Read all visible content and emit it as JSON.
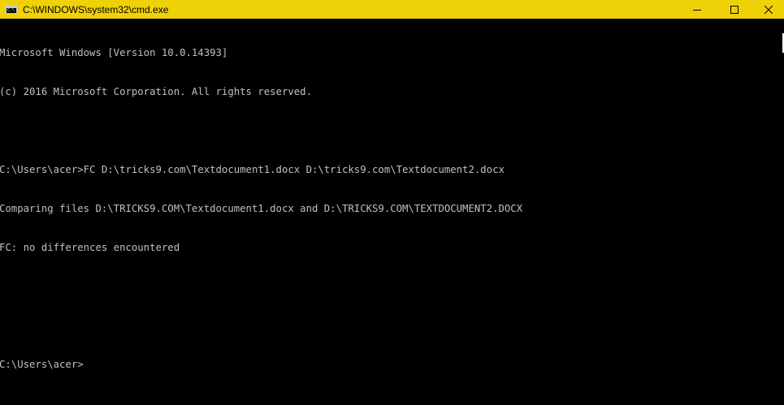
{
  "window": {
    "title": "C:\\WINDOWS\\system32\\cmd.exe",
    "accent_color": "#efd108",
    "icon": "cmd-icon",
    "icon_glyph": "C:\\"
  },
  "controls": {
    "minimize_icon": "minimize-icon",
    "maximize_icon": "maximize-icon",
    "close_icon": "close-icon"
  },
  "console": {
    "lines": [
      "Microsoft Windows [Version 10.0.14393]",
      "(c) 2016 Microsoft Corporation. All rights reserved.",
      "",
      "C:\\Users\\acer>FC D:\\tricks9.com\\Textdocument1.docx D:\\tricks9.com\\Textdocument2.docx",
      "Comparing files D:\\TRICKS9.COM\\Textdocument1.docx and D:\\TRICKS9.COM\\TEXTDOCUMENT2.DOCX",
      "FC: no differences encountered",
      "",
      "",
      "C:\\Users\\acer>"
    ],
    "text_color": "#c0c0c0",
    "background": "#000000"
  }
}
